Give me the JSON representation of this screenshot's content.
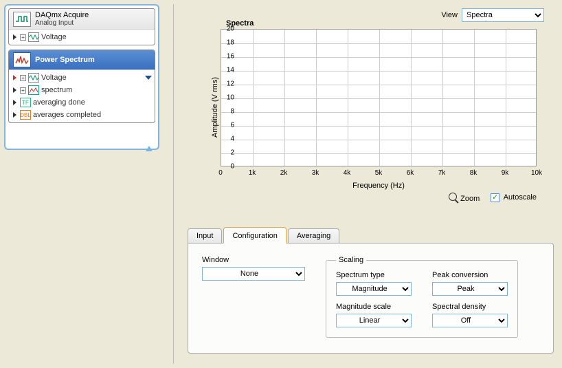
{
  "tree": {
    "daqmx": {
      "title": "DAQmx Acquire",
      "subtitle": "Analog Input",
      "items": [
        {
          "label": "Voltage"
        }
      ]
    },
    "power": {
      "title": "Power Spectrum",
      "items": [
        {
          "label": "Voltage",
          "kind": "in"
        },
        {
          "label": "spectrum",
          "kind": "out"
        },
        {
          "label": "averaging done",
          "kind": "tf"
        },
        {
          "label": "averages completed",
          "kind": "dbl"
        }
      ]
    }
  },
  "view": {
    "label": "View",
    "selected": "Spectra"
  },
  "chart_data": {
    "type": "line",
    "title": "Spectra",
    "xlabel": "Frequency (Hz)",
    "ylabel": "Amplitude (V rms)",
    "xlim": [
      0,
      10000
    ],
    "ylim": [
      0,
      20
    ],
    "xticks": [
      0,
      1000,
      2000,
      3000,
      4000,
      5000,
      6000,
      7000,
      8000,
      9000,
      10000
    ],
    "xtick_labels": [
      "0",
      "1k",
      "2k",
      "3k",
      "4k",
      "5k",
      "6k",
      "7k",
      "8k",
      "9k",
      "10k"
    ],
    "yticks": [
      0,
      2,
      4,
      6,
      8,
      10,
      12,
      14,
      16,
      18,
      20
    ],
    "series": []
  },
  "chart_footer": {
    "zoom": "Zoom",
    "autoscale": "Autoscale",
    "autoscale_checked": true
  },
  "tabs": {
    "items": [
      "Input",
      "Configuration",
      "Averaging"
    ],
    "active": 1
  },
  "config": {
    "window": {
      "label": "Window",
      "value": "None"
    },
    "scaling_legend": "Scaling",
    "spectrum_type": {
      "label": "Spectrum type",
      "value": "Magnitude"
    },
    "peak_conversion": {
      "label": "Peak conversion",
      "value": "Peak"
    },
    "magnitude_scale": {
      "label": "Magnitude scale",
      "value": "Linear"
    },
    "spectral_density": {
      "label": "Spectral density",
      "value": "Off"
    }
  }
}
